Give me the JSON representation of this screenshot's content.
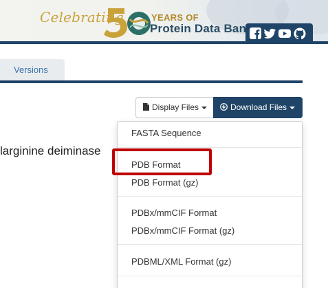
{
  "banner": {
    "celebrating": "Celebrating",
    "years_of": "YEARS OF",
    "org_name": "Protein Data Bank",
    "social_icons": [
      "facebook-icon",
      "twitter-icon",
      "youtube-icon",
      "github-icon"
    ],
    "colors": {
      "gold": "#c9a23a",
      "navy": "#1f4467",
      "teal": "#2b6f66"
    }
  },
  "tabs": {
    "versions": "Versions"
  },
  "toolbar": {
    "display_files": "Display Files",
    "download_files": "Download Files"
  },
  "title_fragment": "larginine deiminase",
  "dropdown": {
    "items": [
      "FASTA Sequence",
      "PDB Format",
      "PDB Format (gz)",
      "PDBx/mmCIF Format",
      "PDBx/mmCIF Format (gz)",
      "PDBML/XML Format (gz)"
    ],
    "highlighted": "PDB Format",
    "highlight_color": "#c00000"
  }
}
